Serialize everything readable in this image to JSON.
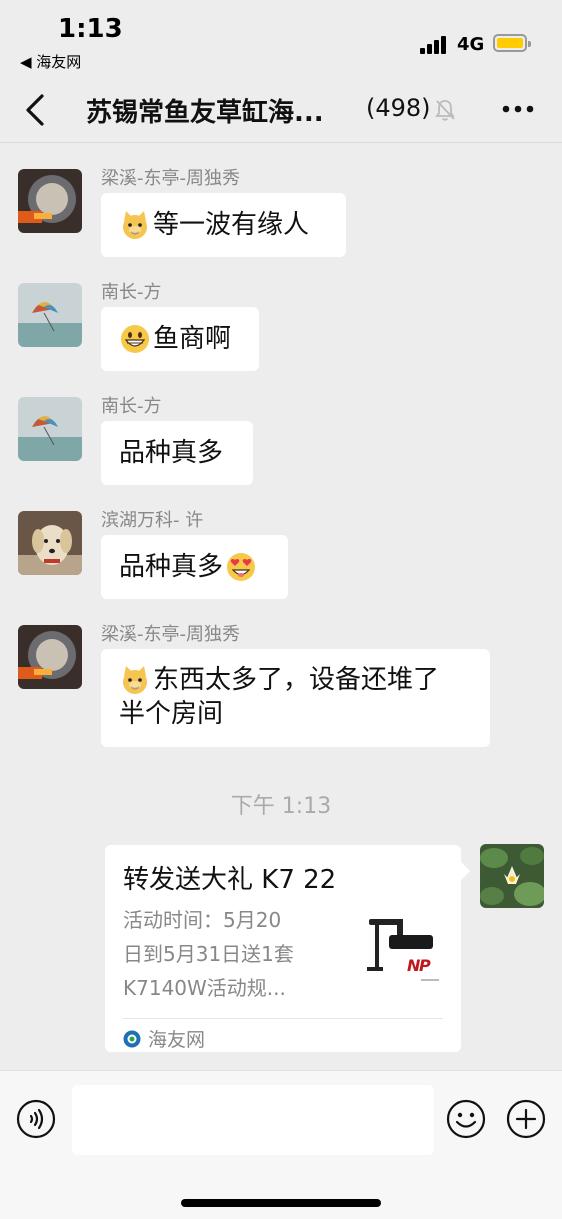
{
  "status_bar": {
    "time": "1:13",
    "back_app": "◀ 海友网",
    "network": "4G"
  },
  "nav": {
    "title": "苏锡常鱼友草缸海...",
    "member_count": "(498)",
    "icons": [
      "back-chevron-icon",
      "mute-bell-icon",
      "more-icon"
    ]
  },
  "messages": [
    {
      "sender": "梁溪-东亭-周独秀",
      "emoji": "cat-face",
      "text": "等一波有缘人",
      "avatar": "helmet-cat"
    },
    {
      "sender": "南长-方",
      "emoji": "grinning-face",
      "text": "鱼商啊",
      "avatar": "parachute"
    },
    {
      "sender": "南长-方",
      "emoji": "",
      "text": "品种真多",
      "avatar": "parachute"
    },
    {
      "sender": "滨湖万科- 许",
      "emoji": "",
      "text": "品种真多",
      "trailing_emoji": "heart-eyes-face",
      "avatar": "puppy"
    },
    {
      "sender": "梁溪-东亭-周独秀",
      "emoji": "cat-face",
      "text": "东西太多了，设备还堆了",
      "text_line2": "半个房间",
      "avatar": "helmet-cat"
    }
  ],
  "timestamp": "下午 1:13",
  "link_card": {
    "title": "转发送大礼 K7 22",
    "desc_line1": "活动时间：5月20",
    "desc_line2": "日到5月31日送1套",
    "desc_line3": "K7140W活动规...",
    "source": "海友网",
    "thumb": "aquarium-lamp-image"
  },
  "input_bar": {
    "placeholder": "",
    "icons": [
      "voice-icon",
      "emoji-icon",
      "plus-icon"
    ]
  },
  "colors": {
    "background": "#ededed",
    "bubble": "#ffffff",
    "battery": "#ffcc00",
    "secondary_text": "#888888"
  }
}
